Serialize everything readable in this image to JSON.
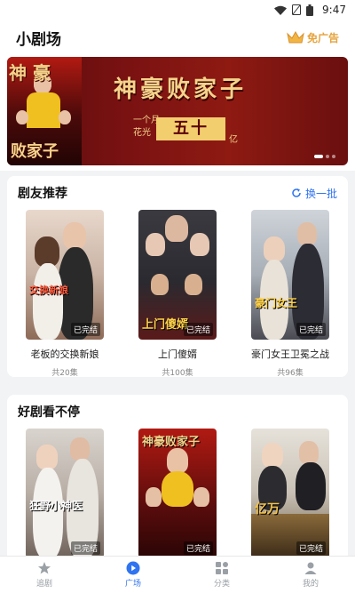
{
  "status_bar": {
    "time": "9:47"
  },
  "header": {
    "title": "小剧场",
    "adfree_label": "免广告"
  },
  "banner": {
    "title": "神豪败家子",
    "poster_text_top": "神 豪",
    "poster_text_bottom": "败家子",
    "line_left_1": "一个月",
    "line_left_2": "花光",
    "box_text": "五十",
    "unit": "亿"
  },
  "section1": {
    "title": "剧友推荐",
    "refresh_label": "换一批",
    "items": [
      {
        "name": "老板的交换新娘",
        "episodes": "共20集",
        "badge": "已完结",
        "cover_text": "交换新娘"
      },
      {
        "name": "上门傻婿",
        "episodes": "共100集",
        "badge": "已完结",
        "cover_text": "上门傻婿"
      },
      {
        "name": "豪门女王卫冕之战",
        "episodes": "共96集",
        "badge": "已完结",
        "cover_text": "豪门女王"
      }
    ]
  },
  "section2": {
    "title": "好剧看不停",
    "items": [
      {
        "badge": "已完结",
        "cover_text": "狂野小神医"
      },
      {
        "badge": "已完结",
        "cover_text": "神豪败家子"
      },
      {
        "badge": "已完结",
        "cover_text": "亿万"
      }
    ]
  },
  "nav": [
    {
      "label": "追剧",
      "icon": "star-icon"
    },
    {
      "label": "广场",
      "icon": "play-icon"
    },
    {
      "label": "分类",
      "icon": "grid-icon"
    },
    {
      "label": "我的",
      "icon": "person-icon"
    }
  ],
  "colors": {
    "accent": "#2f74f0",
    "gold": "#e6a33c"
  }
}
